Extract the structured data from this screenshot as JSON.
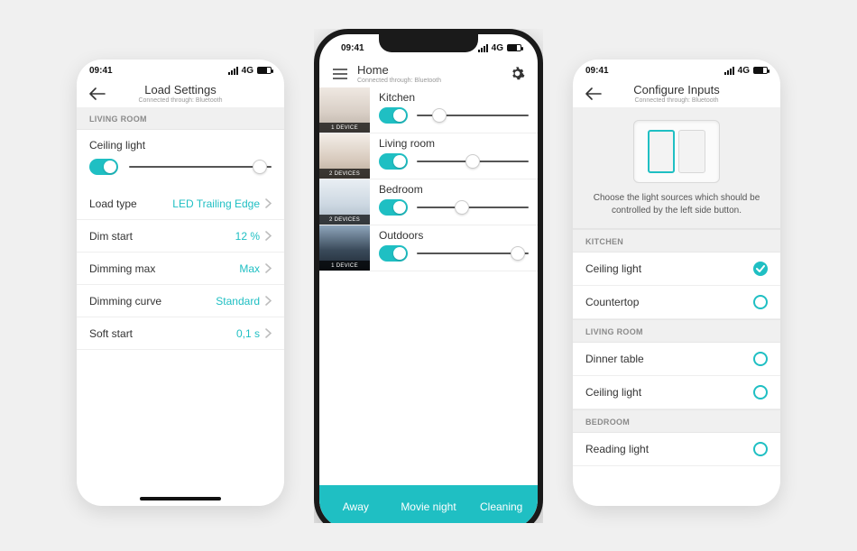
{
  "status": {
    "time": "09:41",
    "net": "4G"
  },
  "left": {
    "title": "Load Settings",
    "subtitle": "Connected through: Bluetooth",
    "section": "LIVING ROOM",
    "control": {
      "name": "Ceiling light",
      "sliderPct": 92
    },
    "rows": [
      {
        "label": "Load type",
        "value": "LED Trailing Edge"
      },
      {
        "label": "Dim start",
        "value": "12 %"
      },
      {
        "label": "Dimming max",
        "value": "Max"
      },
      {
        "label": "Dimming curve",
        "value": "Standard"
      },
      {
        "label": "Soft start",
        "value": "0,1 s"
      }
    ]
  },
  "center": {
    "title": "Home",
    "subtitle": "Connected through: Bluetooth",
    "rooms": [
      {
        "name": "Kitchen",
        "devices": "1 DEVICE",
        "thumb": "kitchen",
        "sliderPct": 20
      },
      {
        "name": "Living room",
        "devices": "2 DEVICES",
        "thumb": "living",
        "sliderPct": 50
      },
      {
        "name": "Bedroom",
        "devices": "2 DEVICES",
        "thumb": "bed",
        "sliderPct": 40
      },
      {
        "name": "Outdoors",
        "devices": "1 DEVICE",
        "thumb": "out",
        "sliderPct": 90
      }
    ],
    "scenes": [
      "Away",
      "Movie night",
      "Cleaning"
    ]
  },
  "right": {
    "title": "Configure Inputs",
    "subtitle": "Connected through: Bluetooth",
    "desc": "Choose the light sources which should be controlled by the left side button.",
    "groups": [
      {
        "header": "KITCHEN",
        "items": [
          {
            "label": "Ceiling light",
            "checked": true
          },
          {
            "label": "Countertop",
            "checked": false
          }
        ]
      },
      {
        "header": "LIVING ROOM",
        "items": [
          {
            "label": "Dinner table",
            "checked": false
          },
          {
            "label": "Ceiling light",
            "checked": false
          }
        ]
      },
      {
        "header": "BEDROOM",
        "items": [
          {
            "label": "Reading light",
            "checked": false
          }
        ]
      }
    ]
  }
}
